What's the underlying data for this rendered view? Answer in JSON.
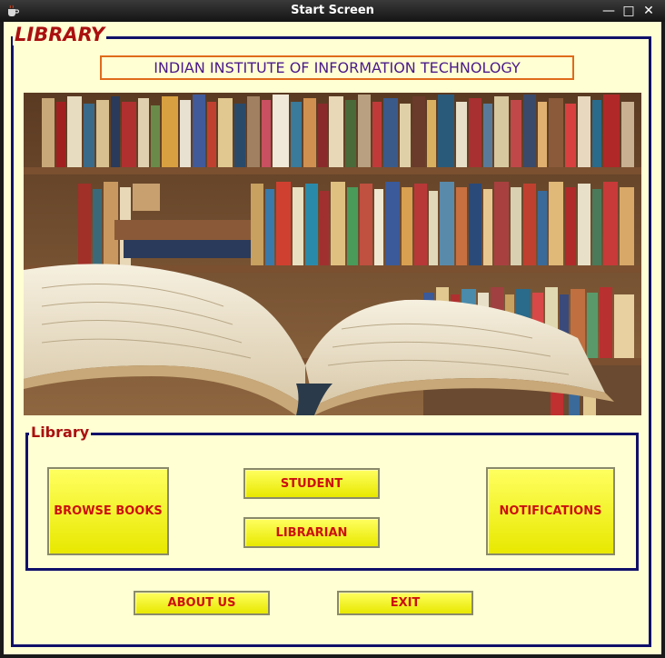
{
  "window": {
    "title": "Start Screen",
    "minimize_glyph": "—",
    "maximize_glyph": "□",
    "close_glyph": "✕"
  },
  "main": {
    "frame_title": "LIBRARY",
    "institute_name": "INDIAN INSTITUTE OF INFORMATION TECHNOLOGY"
  },
  "panel": {
    "frame_title": "Library",
    "browse_books_label": "BROWSE BOOKS",
    "student_label": "STUDENT",
    "librarian_label": "LIBRARIAN",
    "notifications_label": "NOTIFICATIONS"
  },
  "footer": {
    "about_us_label": "ABOUT US",
    "exit_label": "EXIT"
  },
  "colors": {
    "background": "#ffffd3",
    "frame_border": "#10106a",
    "legend_text": "#aa1010",
    "institute_text": "#4a1a8a",
    "institute_border": "#e06a1a",
    "button_fill": "#f0f000",
    "button_text": "#cc1010"
  },
  "icons": {
    "app_icon": "coffee-cup-icon",
    "minimize": "minimize-icon",
    "maximize": "maximize-icon",
    "close": "close-icon"
  }
}
